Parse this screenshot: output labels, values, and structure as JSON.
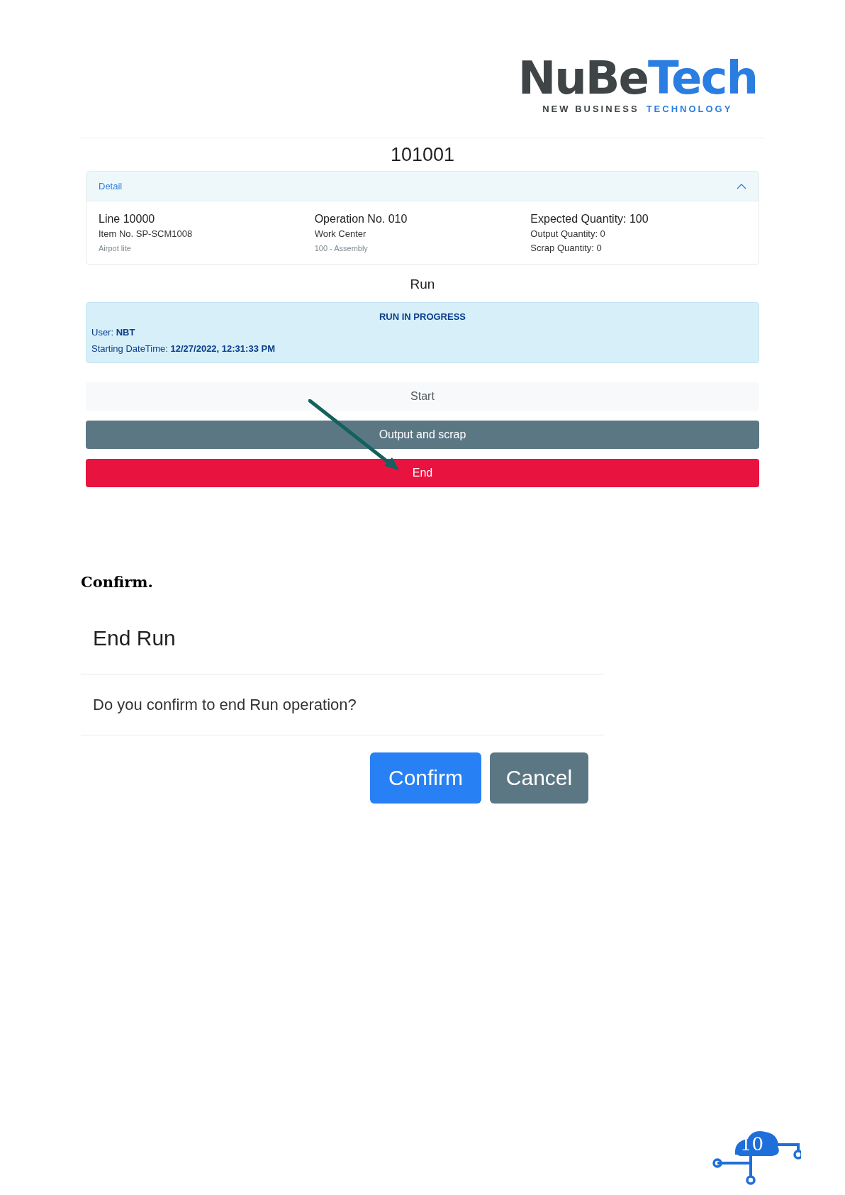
{
  "logo": {
    "word_1": "NuBe",
    "word_2": "Tech",
    "tagline_1": "NEW BUSINESS",
    "tagline_2": "TECHNOLOGY"
  },
  "order": {
    "title": "101001"
  },
  "detail": {
    "label": "Detail",
    "expanded": true,
    "columns": [
      {
        "title": "Line 10000",
        "lines": [
          {
            "text": "Item No. SP-SCM1008",
            "muted": false
          },
          {
            "text": "Airpot lite",
            "muted": true
          }
        ]
      },
      {
        "title": "Operation No. 010",
        "lines": [
          {
            "text": "Work Center",
            "muted": false
          },
          {
            "text": "100 - Assembly",
            "muted": true
          }
        ]
      },
      {
        "title": "Expected Quantity: 100",
        "lines": [
          {
            "text": "Output Quantity: 0",
            "muted": false
          },
          {
            "text": "Scrap Quantity: 0",
            "muted": false
          }
        ]
      }
    ]
  },
  "run": {
    "title": "Run",
    "status": "RUN IN PROGRESS",
    "fields": [
      {
        "label": "User:",
        "value": "NBT"
      },
      {
        "label": "Starting DateTime:",
        "value": "12/27/2022, 12:31:33 PM"
      }
    ]
  },
  "actions": [
    {
      "label": "Start",
      "kind": "light"
    },
    {
      "label": "Output and scrap",
      "kind": "secondary"
    },
    {
      "label": "End",
      "kind": "danger"
    }
  ],
  "caption": "Confirm.",
  "dialog": {
    "title": "End Run",
    "message": "Do you confirm to end Run operation?",
    "buttons": [
      {
        "label": "Confirm",
        "kind": "primary"
      },
      {
        "label": "Cancel",
        "kind": "secondary"
      }
    ]
  },
  "page_number": "10"
}
